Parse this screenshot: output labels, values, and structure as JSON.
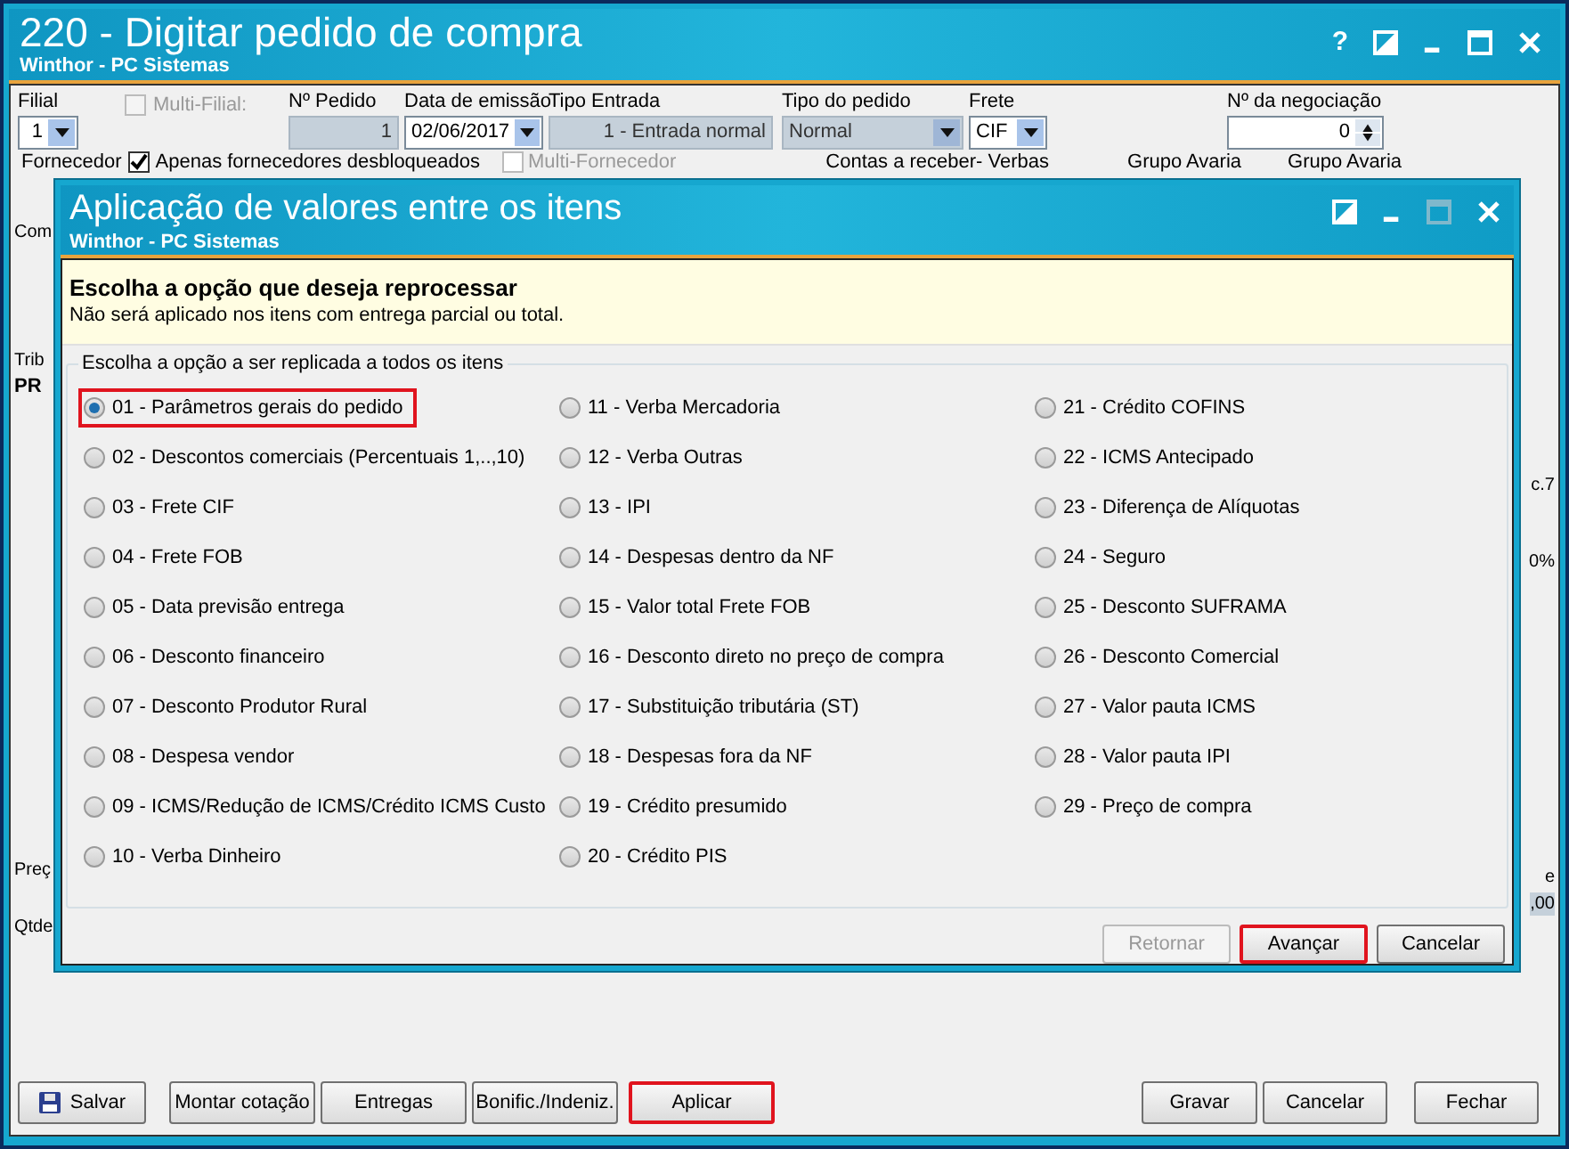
{
  "window": {
    "title": "220 - Digitar pedido de compra",
    "subtitle": "Winthor - PC Sistemas",
    "help": "?"
  },
  "header_fields": [
    {
      "kind": "select",
      "label": "Filial",
      "value": "1",
      "disabled": false
    },
    {
      "kind": "checkbox",
      "label": "Multi-Filial:",
      "checked": false,
      "disabled": true
    },
    {
      "kind": "input",
      "label": "Nº Pedido",
      "value": "1",
      "disabled": true
    },
    {
      "kind": "select",
      "label": "Data de emissão",
      "value": "02/06/2017",
      "disabled": false
    },
    {
      "kind": "input",
      "label": "Tipo Entrada",
      "value": "1 - Entrada normal",
      "disabled": true
    },
    {
      "kind": "select",
      "label": "Tipo do pedido",
      "value": "Normal",
      "disabled": true
    },
    {
      "kind": "select",
      "label": "Frete",
      "value": "CIF",
      "disabled": false
    },
    {
      "kind": "spin",
      "label": "Nº da negociação",
      "value": "0",
      "disabled": false
    }
  ],
  "second_row": {
    "label": "Fornecedor",
    "checkbox": {
      "label": "Apenas fornecedores desbloqueados",
      "checked": true
    },
    "checkbox_2": {
      "label": "Multi-Fornecedor",
      "checked": false,
      "disabled": true
    },
    "labels": [
      "Contas a receber- Verbas",
      "Grupo Avaria",
      "Grupo Avaria"
    ]
  },
  "left_fragments": [
    "Com",
    "Trib",
    "PR",
    "Preç",
    "Qtde"
  ],
  "right_fragments": [
    "c.7",
    "0%",
    "e",
    ",00"
  ],
  "dialog": {
    "title": "Aplicação de valores entre os itens",
    "subtitle": "Winthor - PC Sistemas",
    "heading": "Escolha a opção que deseja reprocessar",
    "note": "Não será aplicado nos itens com entrega parcial ou total.",
    "group_label": "Escolha a opção a ser replicada a todos os itens",
    "options": [
      {
        "label": "01 - Parâmetros gerais do pedido",
        "selected": true,
        "highlighted": true
      },
      {
        "label": "02 - Descontos comerciais (Percentuais 1,..,10)",
        "selected": false,
        "highlighted": false
      },
      {
        "label": "03 - Frete CIF",
        "selected": false,
        "highlighted": false
      },
      {
        "label": "04 - Frete FOB",
        "selected": false,
        "highlighted": false
      },
      {
        "label": "05 - Data previsão entrega",
        "selected": false,
        "highlighted": false
      },
      {
        "label": "06 - Desconto financeiro",
        "selected": false,
        "highlighted": false
      },
      {
        "label": "07 - Desconto Produtor Rural",
        "selected": false,
        "highlighted": false
      },
      {
        "label": "08 - Despesa vendor",
        "selected": false,
        "highlighted": false
      },
      {
        "label": "09 - ICMS/Redução de ICMS/Crédito ICMS Custo",
        "selected": false,
        "highlighted": false
      },
      {
        "label": "10 - Verba Dinheiro",
        "selected": false,
        "highlighted": false
      },
      {
        "label": "11 - Verba Mercadoria",
        "selected": false,
        "highlighted": false
      },
      {
        "label": "12 - Verba Outras",
        "selected": false,
        "highlighted": false
      },
      {
        "label": "13 - IPI",
        "selected": false,
        "highlighted": false
      },
      {
        "label": "14 - Despesas dentro da NF",
        "selected": false,
        "highlighted": false
      },
      {
        "label": "15 - Valor total Frete FOB",
        "selected": false,
        "highlighted": false
      },
      {
        "label": "16 - Desconto direto no preço de compra",
        "selected": false,
        "highlighted": false
      },
      {
        "label": "17 - Substituição tributária (ST)",
        "selected": false,
        "highlighted": false
      },
      {
        "label": "18 - Despesas fora da NF",
        "selected": false,
        "highlighted": false
      },
      {
        "label": "19 - Crédito presumido",
        "selected": false,
        "highlighted": false
      },
      {
        "label": "20 - Crédito PIS",
        "selected": false,
        "highlighted": false
      },
      {
        "label": "21 - Crédito COFINS",
        "selected": false,
        "highlighted": false
      },
      {
        "label": "22 - ICMS Antecipado",
        "selected": false,
        "highlighted": false
      },
      {
        "label": "23 - Diferença de Alíquotas",
        "selected": false,
        "highlighted": false
      },
      {
        "label": "24 - Seguro",
        "selected": false,
        "highlighted": false
      },
      {
        "label": "25 - Desconto SUFRAMA",
        "selected": false,
        "highlighted": false
      },
      {
        "label": "26 - Desconto Comercial",
        "selected": false,
        "highlighted": false
      },
      {
        "label": "27 - Valor pauta ICMS",
        "selected": false,
        "highlighted": false
      },
      {
        "label": "28 - Valor pauta IPI",
        "selected": false,
        "highlighted": false
      },
      {
        "label": "29 - Preço de compra",
        "selected": false,
        "highlighted": false
      }
    ],
    "buttons": [
      {
        "label": "Retornar",
        "disabled": true,
        "highlighted": false
      },
      {
        "label": "Avançar",
        "disabled": false,
        "highlighted": true
      },
      {
        "label": "Cancelar",
        "disabled": false,
        "highlighted": false
      }
    ]
  },
  "footer_buttons": [
    {
      "label": "Salvar",
      "kind": "save",
      "highlighted": false
    },
    {
      "label": "Montar cotação",
      "kind": "plain",
      "highlighted": false
    },
    {
      "label": "Entregas",
      "kind": "plain",
      "highlighted": false
    },
    {
      "label": "Bonific./Indeniz.",
      "kind": "plain",
      "highlighted": false
    },
    {
      "label": "Aplicar",
      "kind": "plain",
      "highlighted": true
    },
    {
      "label": "Gravar",
      "kind": "plain",
      "highlighted": false
    },
    {
      "label": "Cancelar",
      "kind": "plain",
      "highlighted": false
    },
    {
      "label": "Fechar",
      "kind": "plain",
      "highlighted": false
    }
  ]
}
